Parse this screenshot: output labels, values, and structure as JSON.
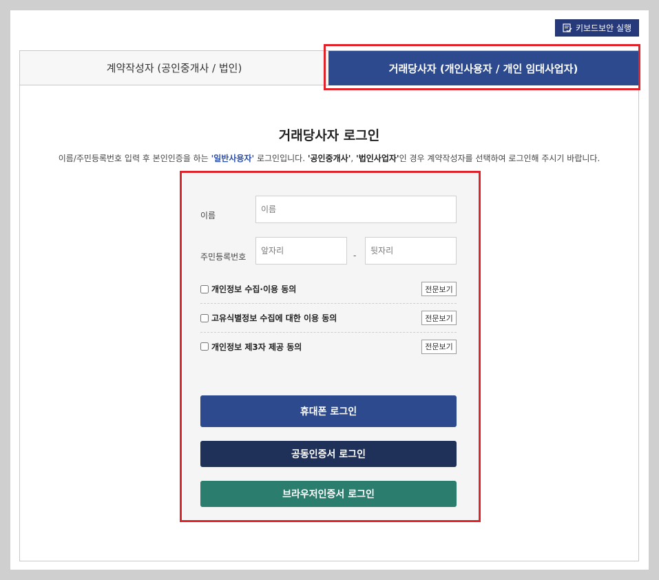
{
  "toolbar": {
    "keyboard_security_label": "키보드보안 실행",
    "keyboard_icon": "keyboard-security-icon"
  },
  "tabs": {
    "contract_writer": "계약작성자 (공인중개사 / 법인)",
    "trading_party": "거래당사자 (개인사용자 / 개인 임대사업자)"
  },
  "login": {
    "title": "거래당사자 로그인",
    "desc_part1": "이름/주민등록번호 입력 후 본인인증을 하는 ",
    "desc_hl1": "'일반사용자'",
    "desc_part2": " 로그인입니다. ",
    "desc_hl2": "'공인중개사'",
    "desc_part3": ", ",
    "desc_hl3": "'법인사업자'",
    "desc_part4": "인 경우 계약작성자를 선택하여 로그인해 주시기 바랍니다."
  },
  "form": {
    "name_label": "이름",
    "name_placeholder": "이름",
    "rrn_label": "주민등록번호",
    "rrn_front_placeholder": "앞자리",
    "rrn_dash": "-",
    "rrn_back_placeholder": "뒷자리"
  },
  "agreements": [
    {
      "label": "개인정보 수집·이용 동의",
      "view_label": "전문보기",
      "checked": false
    },
    {
      "label": "고유식별정보 수집에 대한 이용 동의",
      "view_label": "전문보기",
      "checked": false
    },
    {
      "label": "개인정보 제3자 제공 동의",
      "view_label": "전문보기",
      "checked": false
    }
  ],
  "buttons": {
    "phone_login": "휴대폰 로그인",
    "cert_login": "공동인증서 로그인",
    "browser_cert_login": "브라우저인증서 로그인"
  },
  "colors": {
    "primary": "#2c4a8d",
    "dark_navy": "#1f3158",
    "teal": "#2b7d6d",
    "highlight_red": "#e0222b"
  }
}
